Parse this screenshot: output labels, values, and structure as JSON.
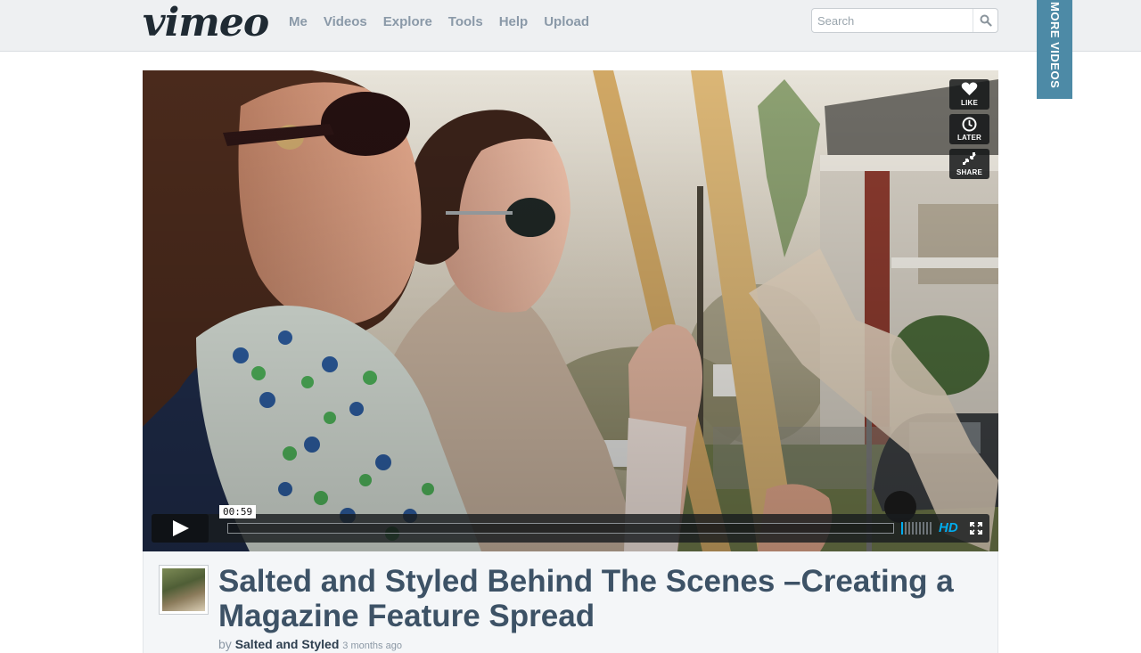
{
  "header": {
    "logo": "vimeo",
    "nav": [
      "Me",
      "Videos",
      "Explore",
      "Tools",
      "Help",
      "Upload"
    ],
    "search_placeholder": "Search"
  },
  "more_videos_label": "MORE VIDEOS",
  "player": {
    "side_buttons": {
      "like": "LIKE",
      "later": "LATER",
      "share": "SHARE"
    },
    "timecode": "00:59",
    "progress": 0,
    "hd_label": "HD",
    "accent_color": "#00adef"
  },
  "video_info": {
    "title": "Salted and Styled Behind The Scenes –Creating a Magazine Feature Spread",
    "by_prefix": "by",
    "author": "Salted and Styled",
    "uploaded": "3 months ago"
  }
}
